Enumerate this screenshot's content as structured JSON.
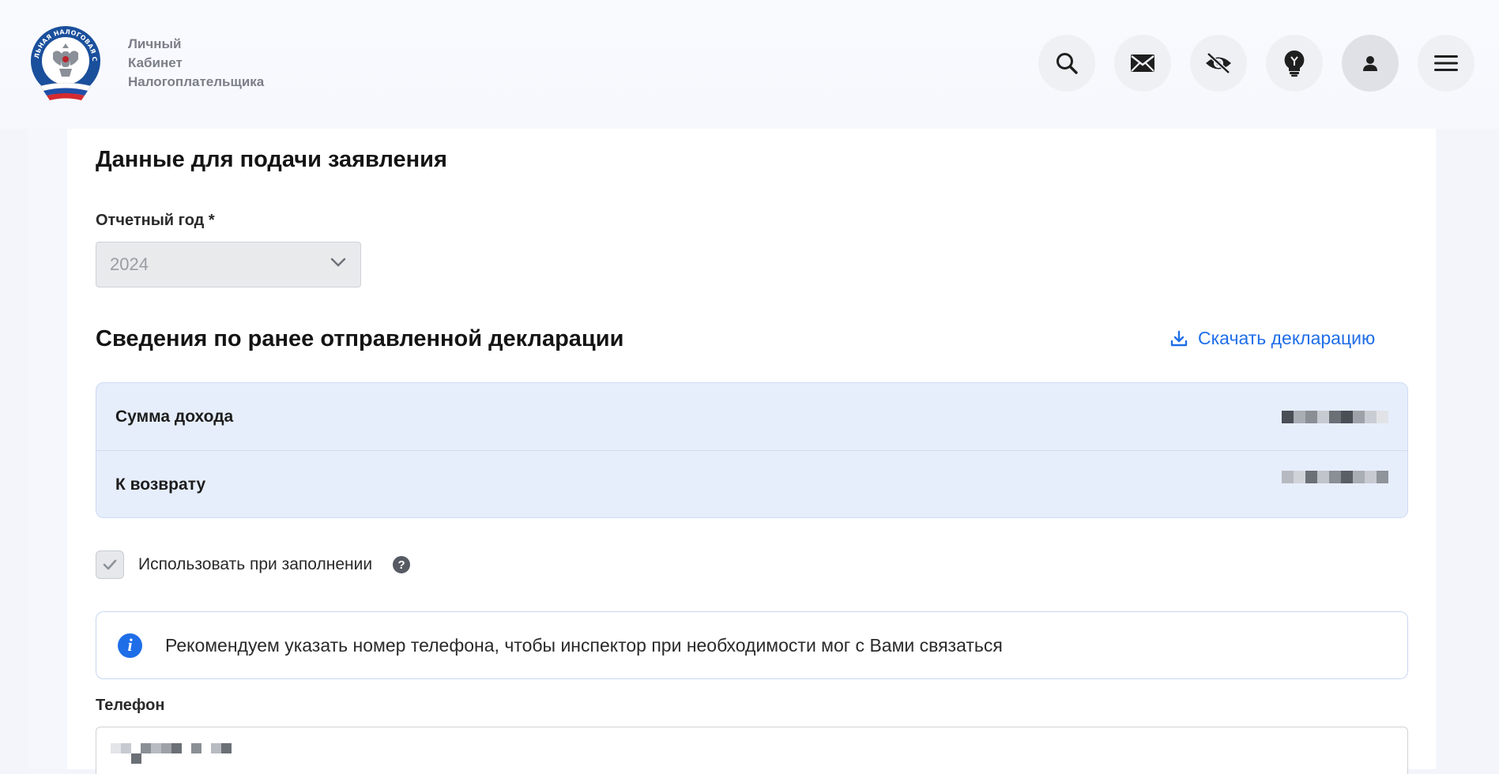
{
  "header": {
    "brand_lines": [
      "Личный",
      "Кабинет",
      "Налогоплательщика"
    ],
    "logo_text": "ФЕДЕРАЛЬНАЯ НАЛОГОВАЯ СЛУЖБА",
    "buttons": [
      "search-icon",
      "mail-icon",
      "eye-off-icon",
      "lightbulb-icon",
      "user-icon",
      "menu-icon"
    ]
  },
  "form": {
    "section_title": "Данные для подачи заявления",
    "year_label": "Отчетный год *",
    "year_value": "2024"
  },
  "declaration": {
    "title": "Сведения по ранее отправленной декларации",
    "download_label": "Скачать декларацию",
    "rows": [
      {
        "label": "Сумма дохода"
      },
      {
        "label": "К возврату"
      }
    ]
  },
  "checkbox": {
    "label": "Использовать при заполнении",
    "checked": true,
    "help": "?"
  },
  "notice": {
    "icon": "i",
    "text": "Рекомендуем указать номер телефона, чтобы инспектор при необходимости мог с Вами связаться"
  },
  "phone": {
    "label": "Телефон"
  },
  "colors": {
    "accent": "#1f6ee8",
    "info_bg": "#e6eefc"
  }
}
